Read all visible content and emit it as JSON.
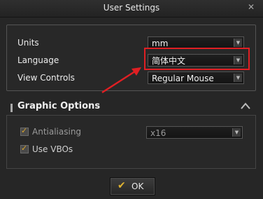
{
  "window": {
    "title": "User Settings",
    "close_glyph": "✕"
  },
  "settings": {
    "units": {
      "label": "Units",
      "value": "mm"
    },
    "language": {
      "label": "Language",
      "value": "简体中文"
    },
    "view_controls": {
      "label": "View Controls",
      "value": "Regular Mouse"
    }
  },
  "graphic_options": {
    "title": "Graphic Options",
    "antialiasing": {
      "label": "Antialiasing",
      "checked": true,
      "value": "x16"
    },
    "use_vbos": {
      "label": "Use VBOs",
      "checked": true
    }
  },
  "footer": {
    "ok_label": "OK"
  },
  "colors": {
    "highlight": "#e01f23",
    "check_accent": "#e2b531",
    "background": "#262626"
  },
  "icons": {
    "close": "close-icon",
    "dropdown": "chevron-down-icon",
    "collapse": "chevron-up-icon",
    "check": "check-icon",
    "arrow": "arrow-annotation-icon"
  }
}
